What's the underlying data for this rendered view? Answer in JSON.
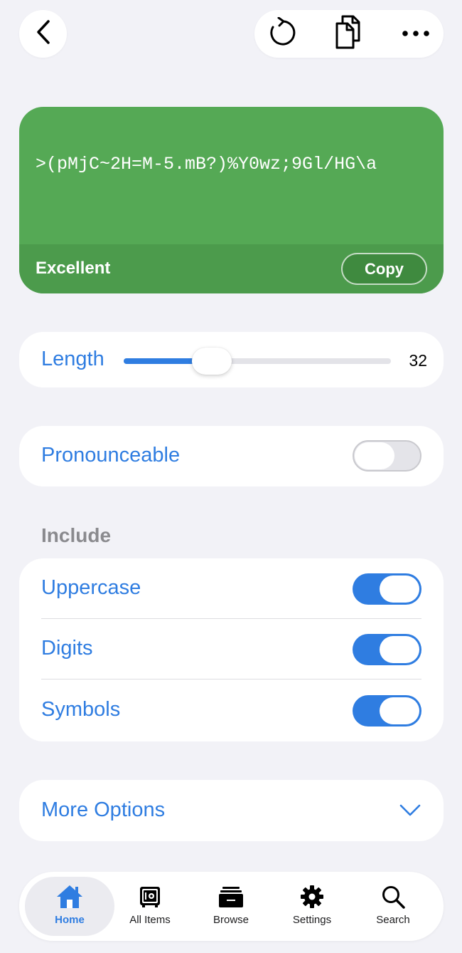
{
  "top_actions": {
    "back_icon": "chevron-left-icon",
    "regenerate_icon": "refresh-icon",
    "copy_icon": "documents-icon",
    "more_icon": "ellipsis-icon"
  },
  "password": {
    "value": ">(pMjC~2H=M-5.mB?)%Y0wz;9Gl/HG\\a",
    "strength": "Excellent",
    "copy_label": "Copy",
    "card_color": "#55a955"
  },
  "length": {
    "label": "Length",
    "value": "32",
    "slider_fraction": 0.33
  },
  "pronounceable": {
    "label": "Pronounceable",
    "enabled": false
  },
  "include": {
    "header": "Include",
    "options": [
      {
        "label": "Uppercase",
        "enabled": true
      },
      {
        "label": "Digits",
        "enabled": true
      },
      {
        "label": "Symbols",
        "enabled": true
      }
    ]
  },
  "more_options": {
    "label": "More Options",
    "icon": "chevron-down-icon"
  },
  "tabbar": {
    "tabs": [
      {
        "label": "Home",
        "icon": "home-icon",
        "active": true
      },
      {
        "label": "All Items",
        "icon": "vault-icon",
        "active": false
      },
      {
        "label": "Browse",
        "icon": "tray-icon",
        "active": false
      },
      {
        "label": "Settings",
        "icon": "gear-icon",
        "active": false
      },
      {
        "label": "Search",
        "icon": "search-icon",
        "active": false
      }
    ]
  },
  "colors": {
    "accent": "#2f7de1",
    "background": "#f2f2f7"
  }
}
